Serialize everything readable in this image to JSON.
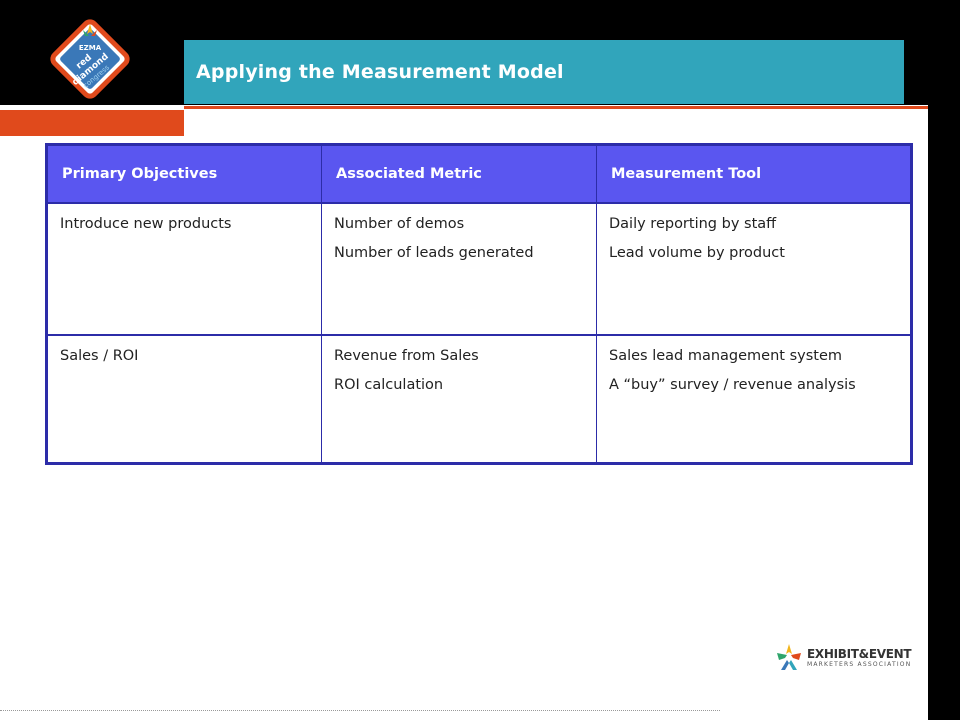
{
  "slide": {
    "title": "Applying the Measurement Model"
  },
  "logo": {
    "top_text": "EZMA",
    "line1": "red",
    "line2": "diamond",
    "line3": "congress"
  },
  "table": {
    "headers": [
      "Primary Objectives",
      "Associated Metric",
      "Measurement Tool"
    ],
    "rows": [
      {
        "objective": "Introduce new products",
        "metrics": [
          "Number of demos",
          "Number of leads generated"
        ],
        "tools": [
          "Daily reporting by staff",
          "Lead volume by product"
        ]
      },
      {
        "objective": "Sales / ROI",
        "metrics": [
          "Revenue from Sales",
          "ROI calculation"
        ],
        "tools": [
          "Sales lead management system",
          "A “buy” survey / revenue analysis"
        ]
      }
    ]
  },
  "footer": {
    "brand_line1": "EXHIBIT&EVENT",
    "brand_line2": "MARKETERS ASSOCIATION"
  },
  "colors": {
    "title_bar": "#31a5bb",
    "accent_orange": "#e04a1c",
    "header_fill": "#5a56f0",
    "table_border": "#2c2ca8"
  }
}
